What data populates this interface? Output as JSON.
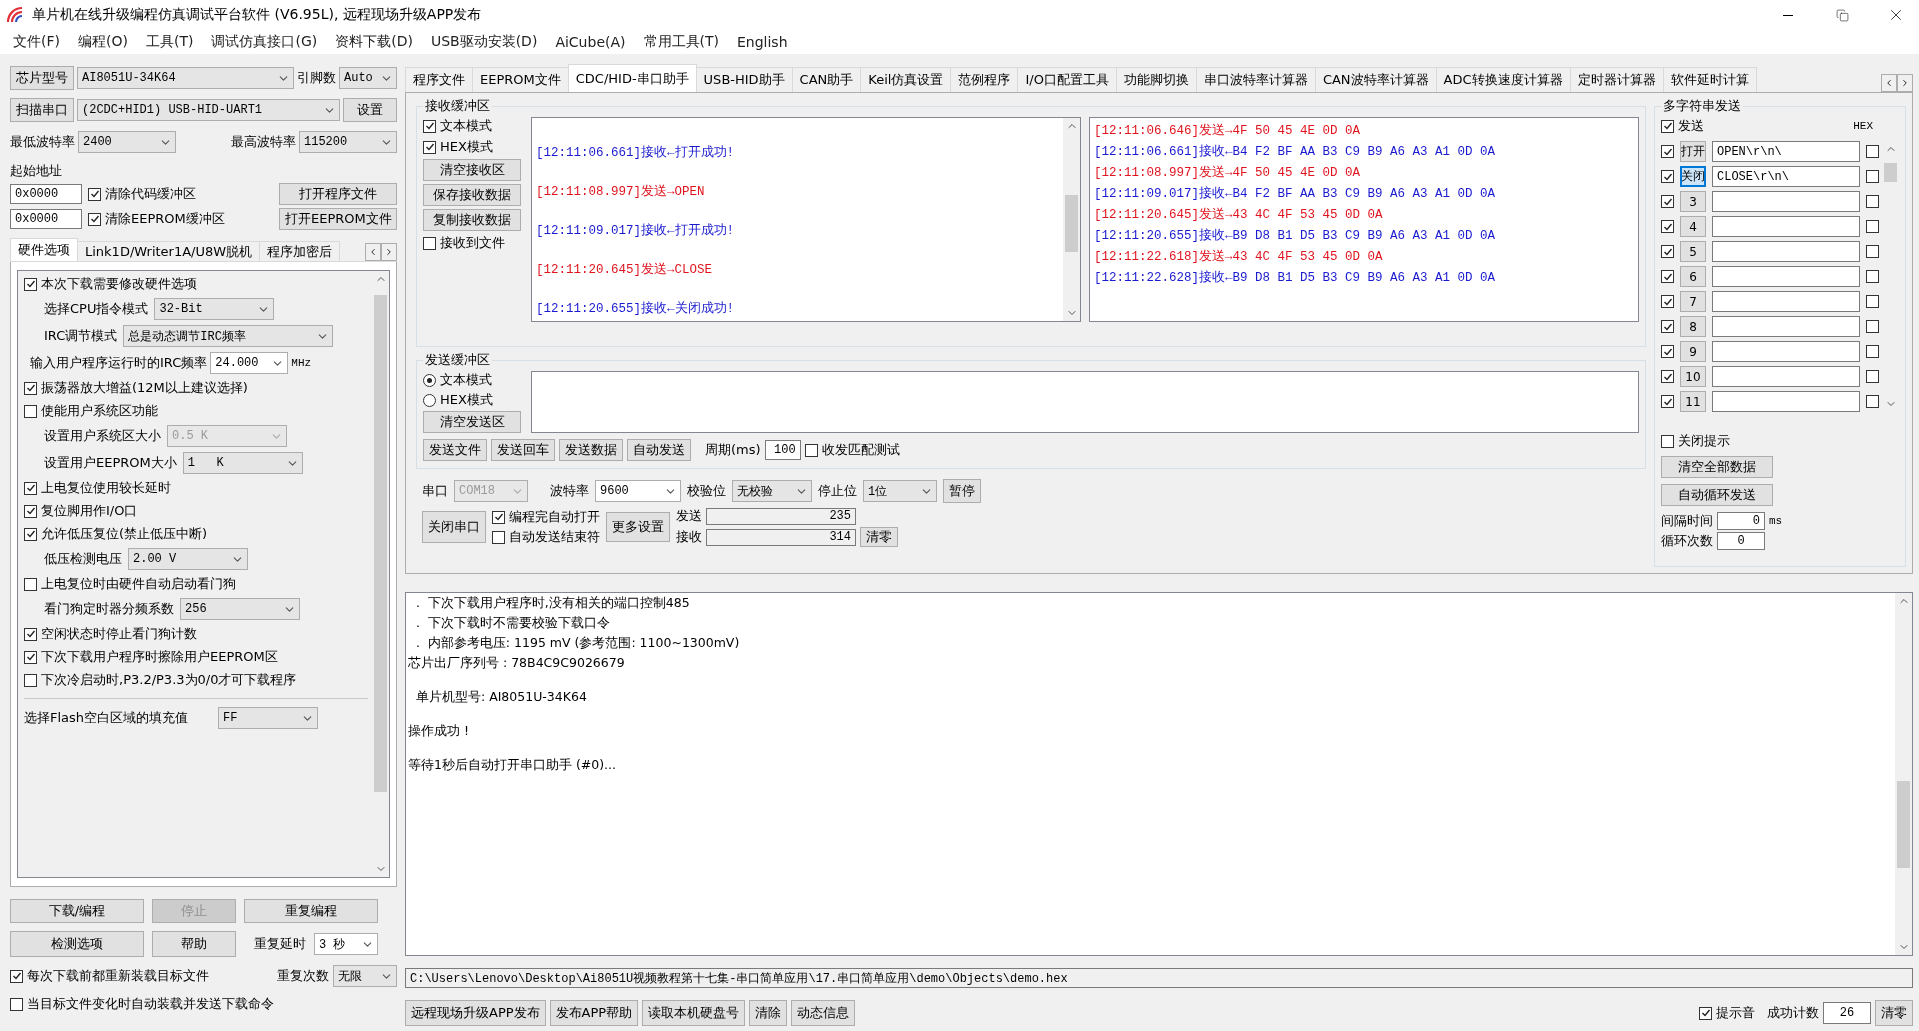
{
  "window": {
    "title": "单片机在线升级编程仿真调试平台软件 (V6.95L), 远程现场升级APP发布"
  },
  "menu": [
    "文件(F)",
    "编程(O)",
    "工具(T)",
    "调试仿真接口(G)",
    "资料下载(D)",
    "USB驱动安装(D)",
    "AiCube(A)",
    "常用工具(T)",
    "English"
  ],
  "left": {
    "chip": {
      "label": "芯片型号",
      "value": "AI8051U-34K64",
      "pins_label": "引脚数",
      "pins": "Auto"
    },
    "port": {
      "label": "扫描串口",
      "value": "(2CDC+HID1) USB-HID-UART1",
      "settings": "设置"
    },
    "baud": {
      "min_label": "最低波特率",
      "min": "2400",
      "max_label": "最高波特率",
      "max": "115200"
    },
    "start_address_label": "起始地址",
    "address_rows": [
      {
        "address": "0x0000",
        "label": "清除代码缓冲区",
        "checked": true,
        "button": "打开程序文件"
      },
      {
        "address": "0x0000",
        "label": "清除EEPROM缓冲区",
        "checked": true,
        "button": "打开EEPROM文件"
      }
    ],
    "tabs": [
      {
        "label": "硬件选项",
        "selected": true
      },
      {
        "label": "Link1D/Writer1A/U8W脱机",
        "selected": false
      },
      {
        "label": "程序加密后",
        "selected": false
      }
    ],
    "options": [
      {
        "kind": "check",
        "label": "本次下载需要修改硬件选项",
        "checked": true
      },
      {
        "kind": "select",
        "label": "选择CPU指令模式",
        "value": "32-Bit",
        "disabled": false
      },
      {
        "kind": "select",
        "label": "IRC调节模式",
        "value": "总是动态调节IRC频率",
        "disabled": false
      },
      {
        "kind": "input",
        "label": "输入用户程序运行时的IRC频率",
        "value": "24.000",
        "unit": "MHz"
      },
      {
        "kind": "check",
        "label": "振荡器放大增益(12M以上建议选择)",
        "checked": true
      },
      {
        "kind": "check",
        "label": "使能用户系统区功能",
        "checked": false
      },
      {
        "kind": "select",
        "label": "设置用户系统区大小",
        "value": "0.5 K",
        "disabled": true
      },
      {
        "kind": "select",
        "label": "设置用户EEPROM大小",
        "value": "1   K",
        "disabled": false
      },
      {
        "kind": "check",
        "label": "上电复位使用较长延时",
        "checked": true
      },
      {
        "kind": "check",
        "label": "复位脚用作I/O口",
        "checked": true
      },
      {
        "kind": "check",
        "label": "允许低压复位(禁止低压中断)",
        "checked": true
      },
      {
        "kind": "select",
        "label": "低压检测电压",
        "value": "2.00 V",
        "disabled": false
      },
      {
        "kind": "check",
        "label": "上电复位时由硬件自动启动看门狗",
        "checked": false
      },
      {
        "kind": "select",
        "label": "看门狗定时器分频系数",
        "value": "256",
        "disabled": false
      },
      {
        "kind": "check",
        "label": "空闲状态时停止看门狗计数",
        "checked": true
      },
      {
        "kind": "check",
        "label": "下次下载用户程序时擦除用户EEPROM区",
        "checked": true
      },
      {
        "kind": "check",
        "label": "下次冷启动时,P3.2/P3.3为0/0才可下载程序",
        "checked": false
      },
      {
        "kind": "fill",
        "label": "选择Flash空白区域的填充值",
        "value": "FF"
      }
    ],
    "buttons": [
      {
        "label": "下载/编程",
        "disabled": false
      },
      {
        "label": "停止",
        "disabled": true
      },
      {
        "label": "重复编程",
        "disabled": false
      },
      {
        "label": "检测选项",
        "disabled": false
      },
      {
        "label": "帮助",
        "disabled": false
      }
    ],
    "repeat_delay": {
      "label": "重复延时",
      "value": "3 秒"
    },
    "repeat_count": {
      "label": "重复次数",
      "value": "无限"
    },
    "bottom_checks": [
      {
        "label": "每次下载前都重新装载目标文件",
        "checked": true
      },
      {
        "label": "当目标文件变化时自动装载并发送下载命令",
        "checked": false
      }
    ]
  },
  "tabs": [
    {
      "label": "程序文件",
      "selected": false
    },
    {
      "label": "EEPROM文件",
      "selected": false
    },
    {
      "label": "CDC/HID-串口助手",
      "selected": true
    },
    {
      "label": "USB-HID助手",
      "selected": false
    },
    {
      "label": "CAN助手",
      "selected": false
    },
    {
      "label": "Keil仿真设置",
      "selected": false
    },
    {
      "label": "范例程序",
      "selected": false
    },
    {
      "label": "I/O口配置工具",
      "selected": false
    },
    {
      "label": "功能脚切换",
      "selected": false
    },
    {
      "label": "串口波特率计算器",
      "selected": false
    },
    {
      "label": "CAN波特率计算器",
      "selected": false
    },
    {
      "label": "ADC转换速度计算器",
      "selected": false
    },
    {
      "label": "定时器计算器",
      "selected": false
    },
    {
      "label": "软件延时计算",
      "selected": false
    }
  ],
  "receive": {
    "title": "接收缓冲区",
    "modes": [
      {
        "label": "文本模式",
        "checked": true
      },
      {
        "label": "HEX模式",
        "checked": true
      }
    ],
    "buttons": [
      "清空接收区",
      "保存接收数据",
      "复制接收数据"
    ],
    "to_file": {
      "label": "接收到文件",
      "checked": false
    },
    "text_lines": [
      {
        "kind": "recv",
        "text": "[12:11:06.661]接收←打开成功!"
      },
      {
        "kind": "send",
        "text": "[12:11:08.997]发送→OPEN"
      },
      {
        "kind": "recv",
        "text": "[12:11:09.017]接收←打开成功!"
      },
      {
        "kind": "send",
        "text": "[12:11:20.645]发送→CLOSE"
      },
      {
        "kind": "recv",
        "text": "[12:11:20.655]接收←关闭成功!"
      }
    ],
    "hex_lines": [
      {
        "kind": "send",
        "text": "[12:11:06.646]发送→4F 50 45 4E 0D 0A"
      },
      {
        "kind": "recv",
        "text": "[12:11:06.661]接收←B4 F2 BF AA B3 C9 B9 A6 A3 A1 0D 0A"
      },
      {
        "kind": "send",
        "text": "[12:11:08.997]发送→4F 50 45 4E 0D 0A"
      },
      {
        "kind": "recv",
        "text": "[12:11:09.017]接收←B4 F2 BF AA B3 C9 B9 A6 A3 A1 0D 0A"
      },
      {
        "kind": "send",
        "text": "[12:11:20.645]发送→43 4C 4F 53 45 0D 0A"
      },
      {
        "kind": "recv",
        "text": "[12:11:20.655]接收←B9 D8 B1 D5 B3 C9 B9 A6 A3 A1 0D 0A"
      },
      {
        "kind": "send",
        "text": "[12:11:22.618]发送→43 4C 4F 53 45 0D 0A"
      },
      {
        "kind": "recv",
        "text": "[12:11:22.628]接收←B9 D8 B1 D5 B3 C9 B9 A6 A3 A1 0D 0A"
      }
    ]
  },
  "send": {
    "title": "发送缓冲区",
    "modes": [
      {
        "label": "文本模式",
        "selected": true
      },
      {
        "label": "HEX模式",
        "selected": false
      }
    ],
    "clear": "清空发送区",
    "buttons": [
      "发送文件",
      "发送回车",
      "发送数据",
      "自动发送"
    ],
    "period_label": "周期(ms)",
    "period": "100",
    "match_test": {
      "label": "收发匹配测试",
      "checked": false
    }
  },
  "serial": {
    "port_label": "串口",
    "port": "COM18",
    "baud_label": "波特率",
    "baud": "9600",
    "parity_label": "校验位",
    "parity": "无校验",
    "stop_label": "停止位",
    "stop": "1位",
    "pause": "暂停",
    "close": "关闭串口",
    "checks": [
      {
        "label": "编程完自动打开",
        "checked": true
      },
      {
        "label": "自动发送结束符",
        "checked": false
      }
    ],
    "more": "更多设置",
    "sent_label": "发送",
    "sent": "235",
    "recv_label": "接收",
    "recv": "314",
    "reset": "清零"
  },
  "multi_send": {
    "title": "多字符串发送",
    "send_all": {
      "label": "发送",
      "checked": true
    },
    "hex_header": "HEX",
    "rows": [
      {
        "checked": true,
        "button": "打开",
        "focused": false,
        "value": "OPEN\\r\\n\\",
        "hex": false
      },
      {
        "checked": true,
        "button": "关闭",
        "focused": true,
        "value": "CLOSE\\r\\n\\",
        "hex": false
      },
      {
        "checked": true,
        "button": "3",
        "focused": false,
        "hex": false
      },
      {
        "checked": true,
        "button": "4",
        "focused": false,
        "hex": false
      },
      {
        "checked": true,
        "button": "5",
        "focused": false,
        "hex": false
      },
      {
        "checked": true,
        "button": "6",
        "focused": false,
        "hex": false
      },
      {
        "checked": true,
        "button": "7",
        "focused": false,
        "hex": false
      },
      {
        "checked": true,
        "button": "8",
        "focused": false,
        "hex": false
      },
      {
        "checked": true,
        "button": "9",
        "focused": false,
        "hex": false
      },
      {
        "checked": true,
        "button": "10",
        "focused": false,
        "hex": false
      },
      {
        "checked": true,
        "button": "11",
        "focused": false,
        "hex": false
      }
    ],
    "close_hint": {
      "label": "关闭提示",
      "checked": false
    },
    "clear_all": "清空全部数据",
    "auto_loop": "自动循环发送",
    "interval_label": "间隔时间",
    "interval": "0",
    "interval_unit": "ms",
    "loop_label": "循环次数",
    "loop": "0"
  },
  "log_paragraphs": [
    [
      "  .  下次下载用户程序时,没有相关的端口控制485",
      "  .  下次下载时不需要校验下载口令",
      "  .  内部参考电压: 1195 mV (参考范围: 1100~1300mV)",
      "芯片出厂序列号 : 78B4C9C9026679"
    ],
    [
      "  单片机型号: AI8051U-34K64"
    ],
    [
      "操作成功 !"
    ],
    [
      "等待1秒后自动打开串口助手 (#0)..."
    ]
  ],
  "file_path": "C:\\Users\\Lenovo\\Desktop\\Ai8051U视频教程第十七集-串口简单应用\\17.串口简单应用\\demo\\Objects\\demo.hex",
  "footer": {
    "buttons": [
      "远程现场升级APP发布",
      "发布APP帮助",
      "读取本机硬盘号",
      "清除",
      "动态信息"
    ],
    "sound": {
      "label": "提示音",
      "checked": true
    },
    "count_label": "成功计数",
    "count": "26",
    "reset": "清零"
  }
}
